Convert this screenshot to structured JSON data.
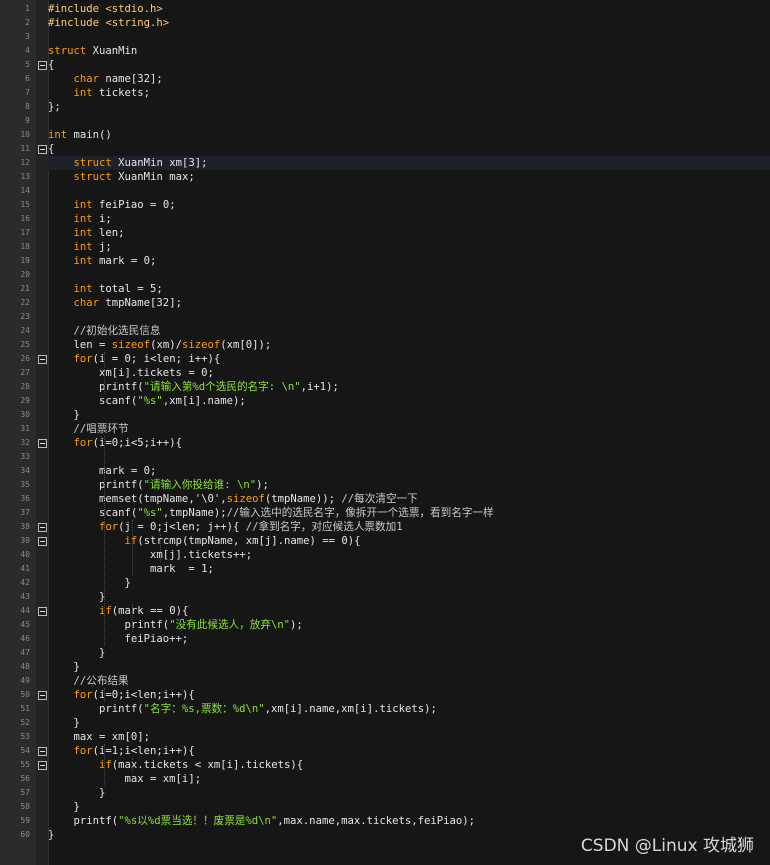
{
  "editor": {
    "accent_color": "#ff9d00",
    "string_color": "#8ae234",
    "current_line": 12,
    "fold_lines": [
      5,
      11,
      26,
      32,
      38,
      39,
      44,
      50,
      54,
      55
    ],
    "lines": [
      "#include <stdio.h>",
      "#include <string.h>",
      "",
      "struct XuanMin",
      "{",
      "    char name[32];",
      "    int tickets;",
      "};",
      "",
      "int main()",
      "{",
      "    struct XuanMin xm[3];",
      "    struct XuanMin max;",
      "",
      "    int feiPiao = 0;",
      "    int i;",
      "    int len;",
      "    int j;",
      "    int mark = 0;",
      "",
      "    int total = 5;",
      "    char tmpName[32];",
      "",
      "    //初始化选民信息",
      "    len = sizeof(xm)/sizeof(xm[0]);",
      "    for(i = 0; i<len; i++){",
      "        xm[i].tickets = 0;",
      "        printf(\"请输入第%d个选民的名字: \\n\",i+1);",
      "        scanf(\"%s\",xm[i].name);",
      "    }",
      "    //唱票环节",
      "    for(i=0;i<5;i++){",
      "",
      "        mark = 0;",
      "        printf(\"请输入你投给谁: \\n\");",
      "        memset(tmpName,'\\0',sizeof(tmpName)); //每次清空一下",
      "        scanf(\"%s\",tmpName);//输入选中的选民名字，像拆开一个选票，看到名字一样",
      "        for(j = 0;j<len; j++){ //拿到名字，对应候选人票数加1",
      "            if(strcmp(tmpName, xm[j].name) == 0){",
      "                xm[j].tickets++;",
      "                mark  = 1;",
      "            }",
      "        }",
      "        if(mark == 0){",
      "            printf(\"没有此候选人，放弃\\n\");",
      "            feiPiao++;",
      "        }",
      "    }",
      "    //公布结果",
      "    for(i=0;i<len;i++){",
      "        printf(\"名字：%s,票数：%d\\n\",xm[i].name,xm[i].tickets);",
      "    }",
      "    max = xm[0];",
      "    for(i=1;i<len;i++){",
      "        if(max.tickets < xm[i].tickets){",
      "            max = xm[i];",
      "        }",
      "    }",
      "    printf(\"%s以%d票当选！！废票是%d\\n\",max.name,max.tickets,feiPiao);",
      "}"
    ]
  },
  "watermark": "CSDN @Linux 攻城狮"
}
